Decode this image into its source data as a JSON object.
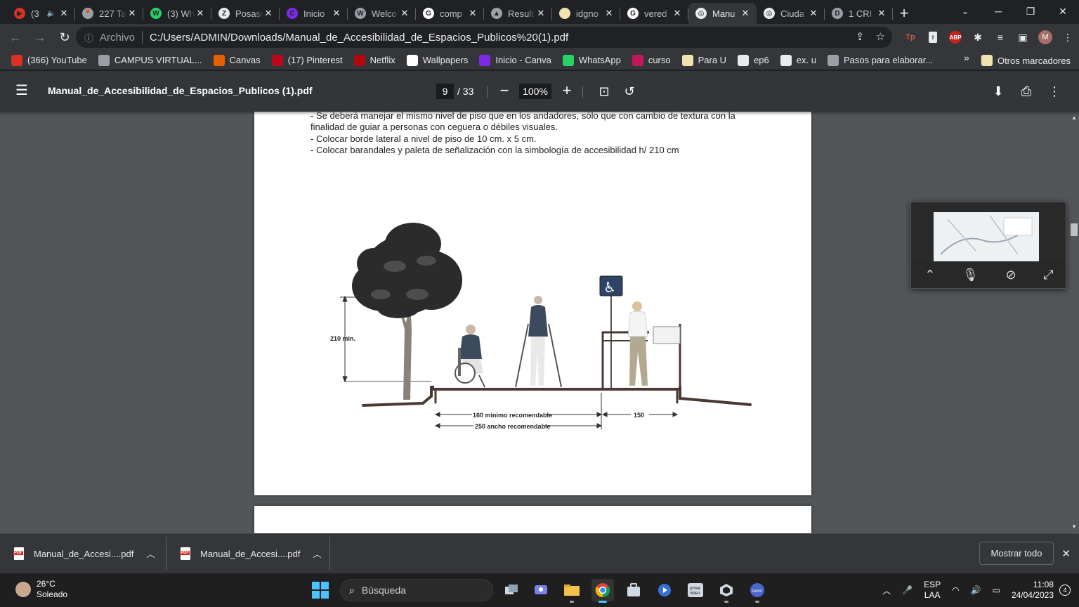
{
  "tabs": [
    {
      "title": "(3",
      "fav_color": "#d93025",
      "fav_glyph": "▶",
      "muted": true
    },
    {
      "title": "227 Ta",
      "fav_color": "#9aa0a6",
      "fav_glyph": "📍"
    },
    {
      "title": "(3) Wh",
      "fav_color": "#25d366",
      "fav_glyph": "W"
    },
    {
      "title": "Posasi",
      "fav_color": "#e8eaed",
      "fav_glyph": "Z"
    },
    {
      "title": "Inicio",
      "fav_color": "#7d2ae8",
      "fav_glyph": "C"
    },
    {
      "title": "Welco",
      "fav_color": "#9aa0a6",
      "fav_glyph": "W"
    },
    {
      "title": "comp",
      "fav_color": "#ffffff",
      "fav_glyph": "G"
    },
    {
      "title": "Result",
      "fav_color": "#9aa0a6",
      "fav_glyph": "▲"
    },
    {
      "title": "idgno",
      "fav_color": "#f1e3b0",
      "fav_glyph": ""
    },
    {
      "title": "vered",
      "fav_color": "#ffffff",
      "fav_glyph": "G"
    },
    {
      "title": "Manu",
      "fav_color": "#e8eaed",
      "fav_glyph": "◎",
      "active": true
    },
    {
      "title": "Ciuda",
      "fav_color": "#e8eaed",
      "fav_glyph": "◎"
    },
    {
      "title": "1 CRI",
      "fav_color": "#9aa0a6",
      "fav_glyph": "D"
    }
  ],
  "toolbar": {
    "scheme_label": "Archivo",
    "url": "C:/Users/ADMIN/Downloads/Manual_de_Accesibilidad_de_Espacios_Publicos%20(1).pdf",
    "avatar_letter": "M"
  },
  "bookmarks": [
    {
      "label": "(366) YouTube",
      "color": "#d93025"
    },
    {
      "label": "CAMPUS VIRTUAL...",
      "color": "#9aa0a6"
    },
    {
      "label": "Canvas",
      "color": "#e66000"
    },
    {
      "label": "(17) Pinterest",
      "color": "#bd081c"
    },
    {
      "label": "Netflix",
      "color": "#b20710"
    },
    {
      "label": "Wallpapers",
      "color": "#ffffff"
    },
    {
      "label": "Inicio - Canva",
      "color": "#7d2ae8"
    },
    {
      "label": "WhatsApp",
      "color": "#25d366"
    },
    {
      "label": "curso",
      "color": "#c2185b"
    },
    {
      "label": "Para U",
      "color": "#f1e3b0"
    },
    {
      "label": "ep6",
      "color": "#e8eaed"
    },
    {
      "label": "ex. u",
      "color": "#e8eaed"
    },
    {
      "label": "Pasos para elaborar...",
      "color": "#9aa0a6"
    }
  ],
  "bookmarks_more": "»",
  "other_bookmarks": "Otros marcadores",
  "pdf": {
    "title": "Manual_de_Accesibilidad_de_Espacios_Publicos (1).pdf",
    "page_current": "9",
    "page_total": "/ 33",
    "zoom": "100%",
    "text_lines": [
      "- Se deberá manejar el mismo nivel de piso que en los andadores,  sólo que con cambio de textura con la",
      "finalidad de guiar a personas con ceguera o débiles visuales.",
      "- Colocar borde lateral a nivel de piso de 10 cm. x  5 cm.",
      "- Colocar barandales y paleta de señalización  con la  simbología de accesibilidad h/ 210 cm"
    ],
    "figure": {
      "height_label": "210 min.",
      "dim_160": "160 minimo recomendable",
      "dim_250": "250 ancho recomendable",
      "dim_150": "150"
    }
  },
  "downloads": [
    {
      "name": "Manual_de_Accesi....pdf"
    },
    {
      "name": "Manual_de_Accesi....pdf"
    }
  ],
  "show_all": "Mostrar todo",
  "taskbar": {
    "temperature": "26°C",
    "weather": "Soleado",
    "search_placeholder": "Búsqueda",
    "lang_top": "ESP",
    "lang_bottom": "LAA",
    "time": "11:08",
    "date": "24/04/2023",
    "notifications": "4"
  }
}
